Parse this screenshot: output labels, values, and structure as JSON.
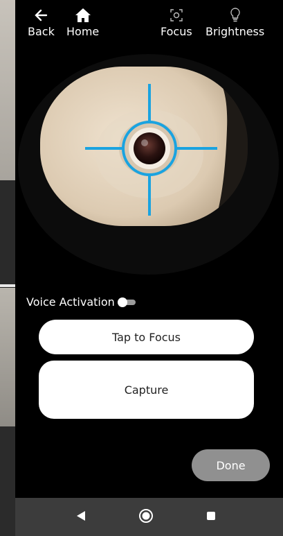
{
  "topbar": {
    "back_label": "Back",
    "home_label": "Home",
    "focus_label": "Focus",
    "brightness_label": "Brightness"
  },
  "icons": {
    "back": "arrow-left-icon",
    "home": "home-icon",
    "focus": "focus-icon",
    "brightness": "lightbulb-icon",
    "nav_back": "triangle-back-icon",
    "nav_home": "circle-home-icon",
    "nav_recent": "square-recents-icon"
  },
  "colors": {
    "crosshair": "#1aa3e0",
    "background": "#000000",
    "done_button": "#909090",
    "nav_bar": "#3c3c3c"
  },
  "controls": {
    "voice_activation_label": "Voice Activation",
    "voice_activation_on": false,
    "tap_to_focus_label": "Tap to Focus",
    "capture_label": "Capture",
    "done_label": "Done"
  }
}
